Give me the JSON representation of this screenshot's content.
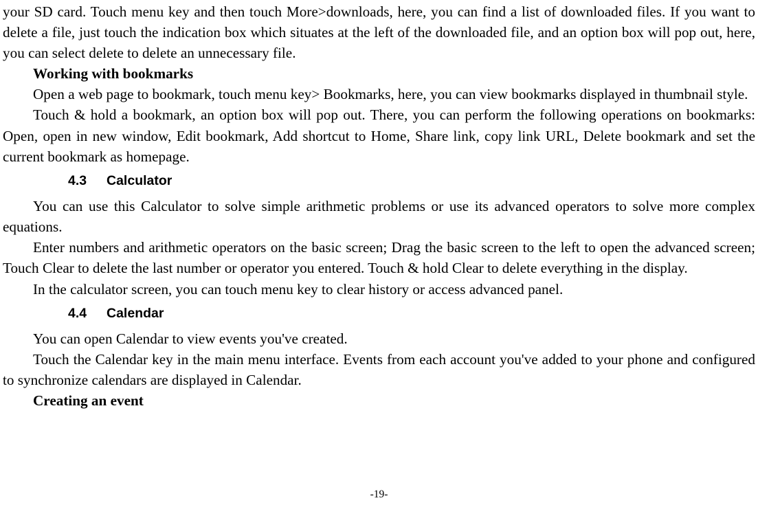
{
  "paragraphs": {
    "p1": "your SD card. Touch menu key and then touch More>downloads, here, you can find a list of downloaded files. If you want to delete a file, just touch the indication box which situates at the left of the downloaded file, and an option box will pop out, here, you can select delete to delete an unnecessary file.",
    "p2": "Working with bookmarks",
    "p3": "Open a web page to bookmark, touch menu key> Bookmarks, here, you can view bookmarks displayed in thumbnail style.",
    "p4": "Touch & hold a bookmark, an option box will pop out. There, you can perform the following operations on bookmarks: Open, open in new window, Edit bookmark, Add shortcut to Home, Share link, copy link URL, Delete bookmark and set the current bookmark as homepage.",
    "p5": "You can use this Calculator to solve simple arithmetic problems or use its advanced operators to solve more complex equations.",
    "p6": "Enter numbers and arithmetic operators on the basic screen; Drag the basic screen to the left to open the advanced screen; Touch Clear to delete the last number or operator you entered. Touch & hold Clear to delete everything in the display.",
    "p7": "In the calculator screen, you can touch menu key to clear history or access advanced panel.",
    "p8": "You can open Calendar to view events you've created.",
    "p9": "Touch the Calendar key in the main menu interface. Events from each account you've added to your phone and configured to synchronize calendars are displayed in Calendar.",
    "p10": "Creating an event"
  },
  "headings": {
    "h43_num": "4.3",
    "h43_title": "Calculator",
    "h44_num": "4.4",
    "h44_title": "Calendar"
  },
  "footer": "-19-"
}
